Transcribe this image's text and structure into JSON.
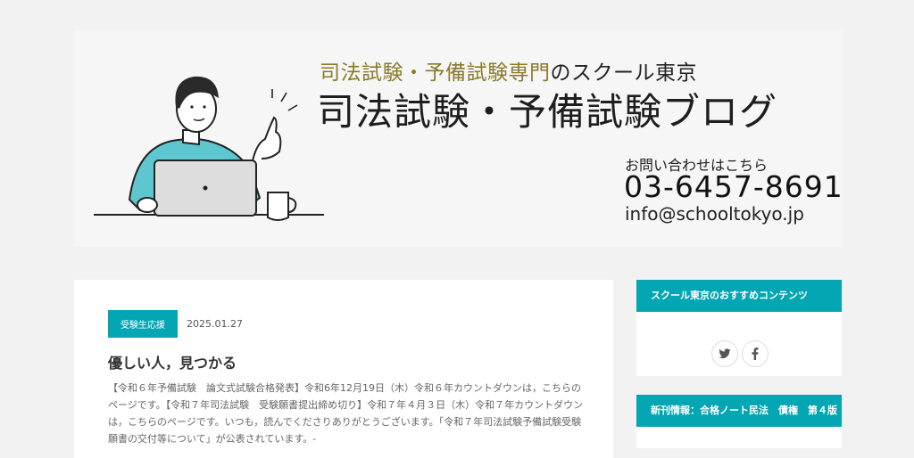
{
  "header": {
    "tagline_highlight": "司法試験・予備試験専門",
    "tagline_rest": "のスクール東京",
    "site_title": "司法試験・予備試験ブログ",
    "contact_label": "お問い合わせはこちら",
    "phone": "03-6457-8691",
    "email": "info@schooltokyo.jp"
  },
  "article": {
    "category": "受験生応援",
    "date": "2025.01.27",
    "title": "優しい人，見つかる",
    "excerpt": "【令和６年予備試験　論文式試験合格発表】令和6年12月19日（木）令和６年カウントダウンは，こちらのページです。【令和７年司法試験　受験願書提出締め切り】令和７年４月３日（木）令和７年カウントダウンは，こちらのページです。いつも，読んでくださりありがとうございます。「令和７年司法試験予備試験受験願書の交付等について」が公表されています。-"
  },
  "sidebar": {
    "widget1_title": "スクール東京のおすすめコンテンツ",
    "twitter_icon": "twitter-icon",
    "facebook_icon": "facebook-icon",
    "widget2_title": "新刊情報：合格ノート民法　債権　第４版"
  },
  "colors": {
    "accent": "#05a6b3",
    "tagline_highlight": "#8a7a2a"
  }
}
